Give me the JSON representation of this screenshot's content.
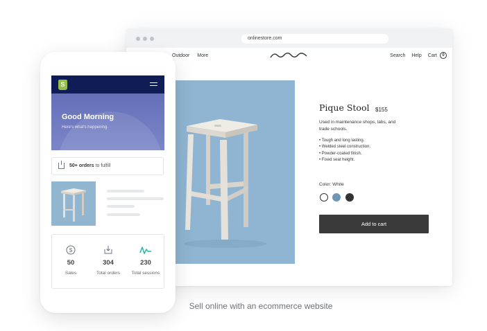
{
  "browser": {
    "url": "onlinestore.com",
    "nav_left": [
      "Outdoor",
      "More"
    ],
    "nav_right": [
      "Search",
      "Help",
      "Cart"
    ],
    "cart_count": "0"
  },
  "product": {
    "title": "Pique Stool",
    "price": "$155",
    "description": "Used in maintenance shops, labs, and trade schools.",
    "features": [
      "• Tough and long lasting.",
      "• Welded steel construction.",
      "• Powder-coated finish.",
      "• Fixed seat height."
    ],
    "color_label": "Color: White",
    "swatches": [
      "#ffffff",
      "#6f96b4",
      "#333333"
    ],
    "add_to_cart": "Add to cart"
  },
  "phone": {
    "greeting": "Good Morning",
    "sub_greeting": "Here's what's happening.",
    "orders_bold": "50+ orders",
    "orders_rest": " to fulfill",
    "stats": [
      {
        "value": "50",
        "label": "Sales"
      },
      {
        "value": "304",
        "label": "Total orders"
      },
      {
        "value": "230",
        "label": "Total sessions"
      }
    ]
  },
  "caption": "Sell online with an ecommerce website",
  "colors": {
    "header_dark": "#0f1c55",
    "header_gradient": "#6b76bd",
    "shopify_green": "#95bf47",
    "button_dark": "#3a3a3a",
    "sessions_teal": "#2bb3a6"
  }
}
